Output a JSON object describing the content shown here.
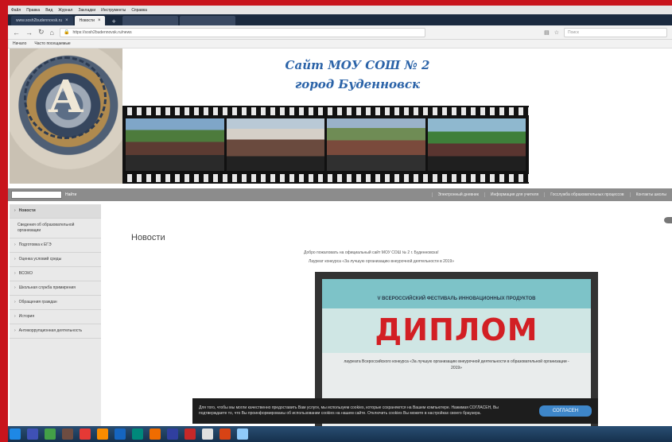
{
  "browser": {
    "menu": [
      "Файл",
      "Правка",
      "Вид",
      "Журнал",
      "Закладки",
      "Инструменты",
      "Справка"
    ],
    "tabs": [
      {
        "label": "www.sosh2budennovsk.ru",
        "active": false
      },
      {
        "label": "Новости",
        "active": true
      }
    ],
    "url": "https://sosh2budennovsk.ru/news",
    "search_placeholder": "Поиск",
    "bookmarks": [
      "Начало",
      "Часто посещаемые"
    ]
  },
  "site": {
    "title_line1": "Сайт МОУ СОШ № 2",
    "title_line2": "город Буденновск",
    "emblem_letter": "А",
    "search_button": "Найти",
    "top_links": [
      "Электронный дневник",
      "Информация для учителя",
      "Госслужба образовательных процессов",
      "Контакты школы"
    ]
  },
  "sidebar": {
    "items": [
      "Новости",
      "Сведения об образовательной организации",
      "Подготовка к ЕГЭ",
      "Оценка условий среды",
      "ВСОКО",
      "Школьная служба примирения",
      "Обращения граждан",
      "История",
      "Антикоррупционная деятельность"
    ]
  },
  "content": {
    "heading": "Новости",
    "greeting": "Добро пожаловать на официальный сайт МОУ СОШ № 2 г. Буденновска!",
    "subtext": "Лауреат конкурса «За лучшую организацию внеурочной деятельности в 2019»",
    "diploma": {
      "header": "V ВСЕРОССИЙСКИЙ ФЕСТИВАЛЬ ИННОВАЦИОННЫХ ПРОДУКТОВ",
      "word": "ДИПЛОМ",
      "text": "лауреата Всероссийского конкурса «За лучшую организацию внеурочной деятельности в образовательной организации - 2019»"
    }
  },
  "cookie": {
    "text": "Для того, чтобы мы могли качественно предоставить Вам услуги, мы используем cookies, которые сохраняются на Вашем компьютере. Нажимая СОГЛАСЕН, Вы подтверждаете то, что Вы проинформированы об использовании cookies на нашем сайте. Отключить cookies Вы можете в настройках своего браузера.",
    "button": "СОГЛАСЕН"
  },
  "colors": {
    "frame": "#c8141c",
    "title": "#2b63a8",
    "diploma_red": "#d21f24",
    "cookie_button": "#3e86c9"
  }
}
